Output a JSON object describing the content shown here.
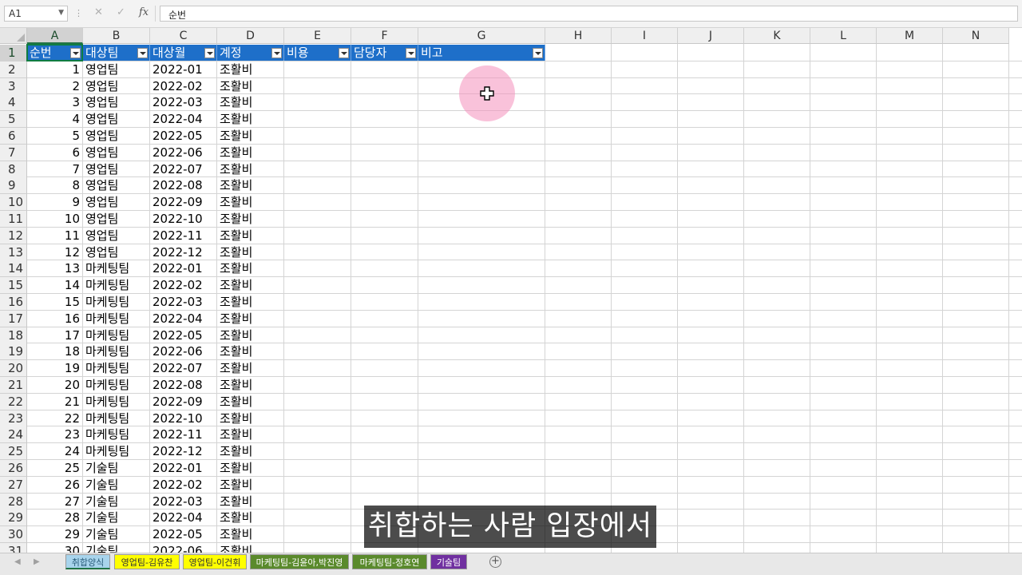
{
  "formula_bar": {
    "name_box": "A1",
    "cancel_icon": "✕",
    "enter_icon": "✓",
    "fx_label": "fx",
    "content": "순번"
  },
  "columns": [
    "A",
    "B",
    "C",
    "D",
    "E",
    "F",
    "G",
    "H",
    "I",
    "J",
    "K",
    "L",
    "M",
    "N"
  ],
  "rows": [
    "1",
    "2",
    "3",
    "4",
    "5",
    "6",
    "7",
    "8",
    "9",
    "10",
    "11",
    "12",
    "13",
    "14",
    "15",
    "16",
    "17",
    "18",
    "19",
    "20",
    "21",
    "22",
    "23",
    "24",
    "25",
    "26",
    "27",
    "28",
    "29",
    "30",
    "31"
  ],
  "table": {
    "headers": [
      "순번",
      "대상팀",
      "대상월",
      "계정",
      "비용",
      "담당자",
      "비고"
    ],
    "rows": [
      [
        "1",
        "영업팀",
        "2022-01",
        "조활비"
      ],
      [
        "2",
        "영업팀",
        "2022-02",
        "조활비"
      ],
      [
        "3",
        "영업팀",
        "2022-03",
        "조활비"
      ],
      [
        "4",
        "영업팀",
        "2022-04",
        "조활비"
      ],
      [
        "5",
        "영업팀",
        "2022-05",
        "조활비"
      ],
      [
        "6",
        "영업팀",
        "2022-06",
        "조활비"
      ],
      [
        "7",
        "영업팀",
        "2022-07",
        "조활비"
      ],
      [
        "8",
        "영업팀",
        "2022-08",
        "조활비"
      ],
      [
        "9",
        "영업팀",
        "2022-09",
        "조활비"
      ],
      [
        "10",
        "영업팀",
        "2022-10",
        "조활비"
      ],
      [
        "11",
        "영업팀",
        "2022-11",
        "조활비"
      ],
      [
        "12",
        "영업팀",
        "2022-12",
        "조활비"
      ],
      [
        "13",
        "마케팅팀",
        "2022-01",
        "조활비"
      ],
      [
        "14",
        "마케팅팀",
        "2022-02",
        "조활비"
      ],
      [
        "15",
        "마케팅팀",
        "2022-03",
        "조활비"
      ],
      [
        "16",
        "마케팅팀",
        "2022-04",
        "조활비"
      ],
      [
        "17",
        "마케팅팀",
        "2022-05",
        "조활비"
      ],
      [
        "18",
        "마케팅팀",
        "2022-06",
        "조활비"
      ],
      [
        "19",
        "마케팅팀",
        "2022-07",
        "조활비"
      ],
      [
        "20",
        "마케팅팀",
        "2022-08",
        "조활비"
      ],
      [
        "21",
        "마케팅팀",
        "2022-09",
        "조활비"
      ],
      [
        "22",
        "마케팅팀",
        "2022-10",
        "조활비"
      ],
      [
        "23",
        "마케팅팀",
        "2022-11",
        "조활비"
      ],
      [
        "24",
        "마케팅팀",
        "2022-12",
        "조활비"
      ],
      [
        "25",
        "기술팀",
        "2022-01",
        "조활비"
      ],
      [
        "26",
        "기술팀",
        "2022-02",
        "조활비"
      ],
      [
        "27",
        "기술팀",
        "2022-03",
        "조활비"
      ],
      [
        "28",
        "기술팀",
        "2022-04",
        "조활비"
      ],
      [
        "29",
        "기술팀",
        "2022-05",
        "조활비"
      ],
      [
        "30",
        "기술팀",
        "2022-06",
        "조활비"
      ]
    ]
  },
  "caption": "취합하는 사람 입장에서",
  "sheet_nav": {
    "prev": "◀",
    "next": "▶",
    "add": "+"
  },
  "sheet_tabs": [
    {
      "label": "취합양식",
      "bg": "#a8d4ec",
      "color": "#2a5d7a",
      "active": true
    },
    {
      "label": "영업팀-김유찬",
      "bg": "#ffff00",
      "color": "#333333",
      "active": false
    },
    {
      "label": "영업팀-이건휘",
      "bg": "#ffff00",
      "color": "#333333",
      "active": false
    },
    {
      "label": "마케팅팀-김윤아,박진영",
      "bg": "#5a8a2c",
      "color": "#ffffff",
      "active": false
    },
    {
      "label": "마케팅팀-정호연",
      "bg": "#5a8a2c",
      "color": "#ffffff",
      "active": false
    },
    {
      "label": "기술팀",
      "bg": "#7030a0",
      "color": "#ffffff",
      "active": false
    }
  ],
  "colors": {
    "header_fill": "#1e6fc9",
    "selection": "#107c41"
  }
}
